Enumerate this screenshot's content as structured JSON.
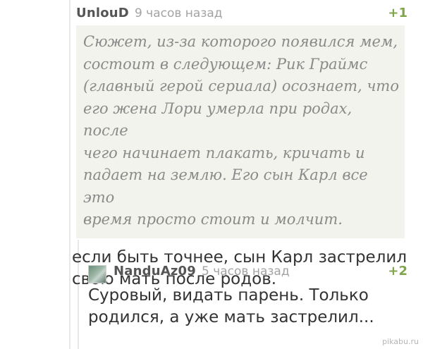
{
  "comments": [
    {
      "author": "UnlouD",
      "time": "9 часов назад",
      "rating": "+1",
      "quote": "Сюжет, из-за которого появился мем,\nсостоит в следующем: Рик Граймс\n(главный герой сериала) осознает, что\nего жена Лори умерла при родах, после\nчего начинает плакать, кричать и\nпадает на землю. Его сын Карл все это\nвремя просто стоит и молчит.",
      "text": "если быть точнее, сын Карл застрелил\nсвою мать после родов."
    },
    {
      "author": "NanduAz09",
      "time": "5 часов назад",
      "rating": "+2",
      "text": "Суровый, видать парень. Только\nродился, а уже мать застрелил..."
    }
  ],
  "watermark": "pikabu.ru",
  "colors": {
    "rating": "#7fa44a",
    "quote_bg": "#f2f3ec",
    "time": "#a3a3a3"
  }
}
